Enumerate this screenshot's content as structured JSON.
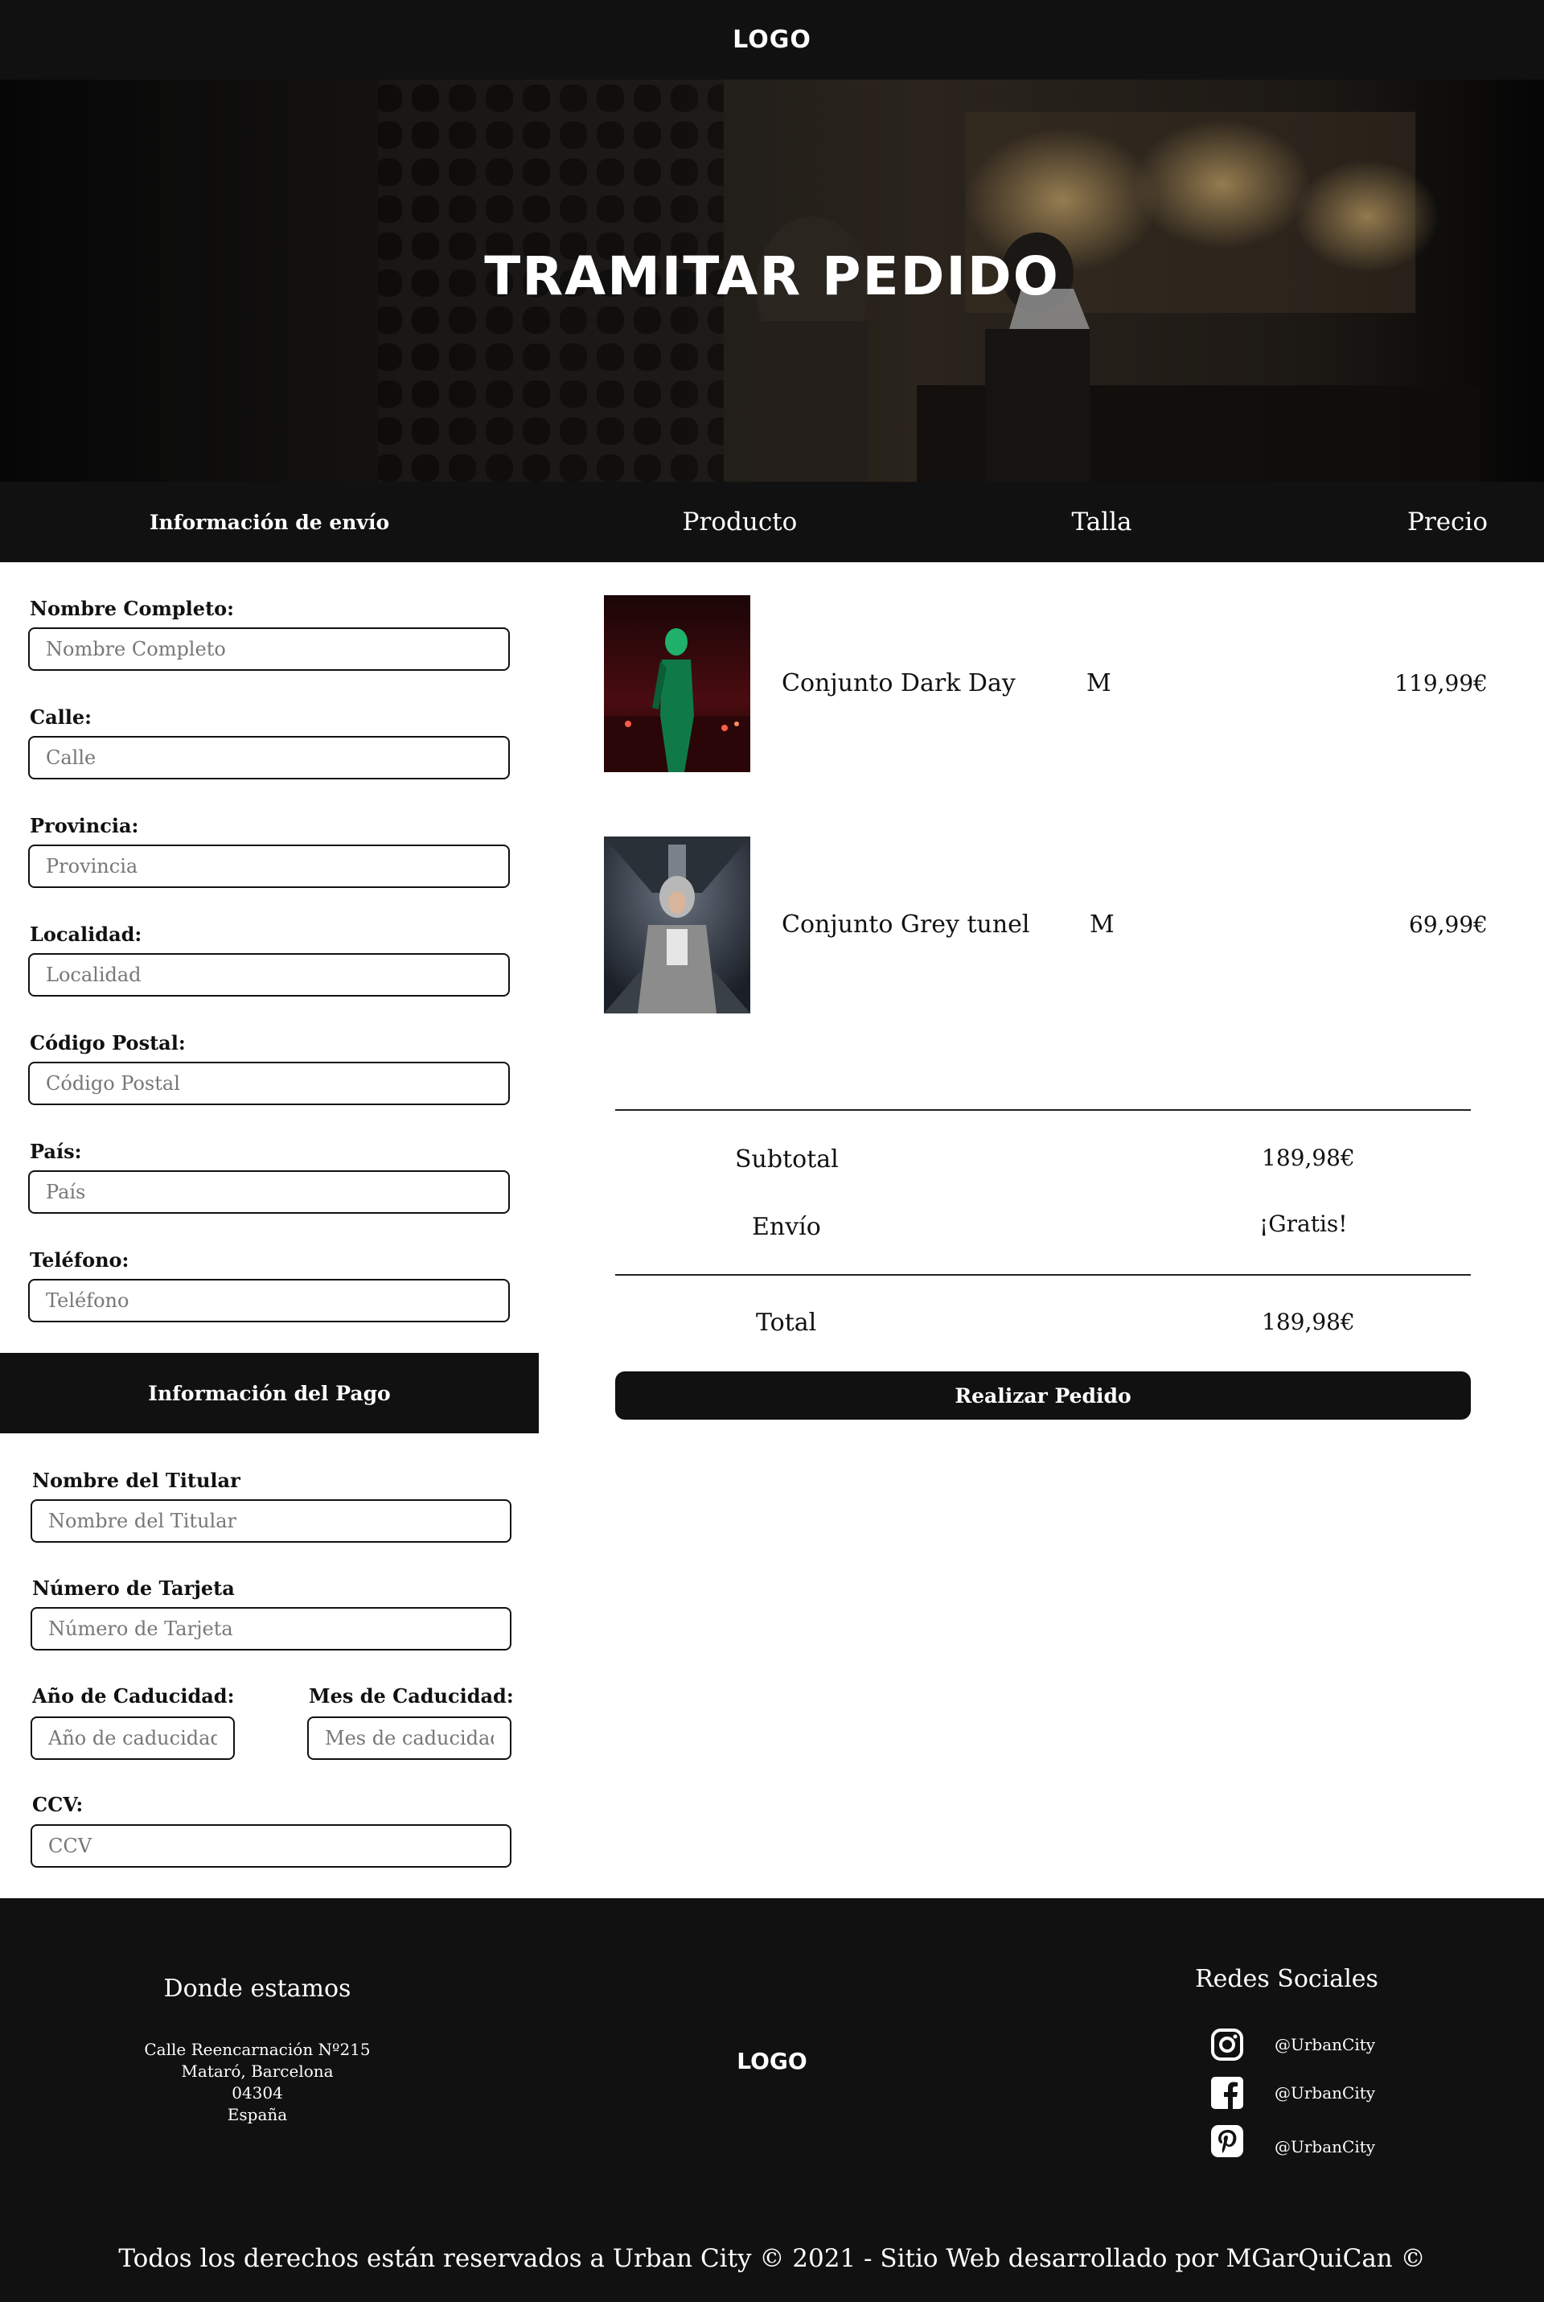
{
  "header": {
    "logo": "LOGO"
  },
  "hero": {
    "title": "TRAMITAR PEDIDO"
  },
  "columns": {
    "shipping_title": "Información de envío",
    "producto": "Producto",
    "talla": "Talla",
    "precio": "Precio"
  },
  "shipping_form": {
    "fields": [
      {
        "label": "Nombre Completo:",
        "placeholder": "Nombre Completo",
        "value": ""
      },
      {
        "label": "Calle:",
        "placeholder": "Calle",
        "value": ""
      },
      {
        "label": "Provincia:",
        "placeholder": "Provincia",
        "value": ""
      },
      {
        "label": "Localidad:",
        "placeholder": "Localidad",
        "value": ""
      },
      {
        "label": "Código Postal:",
        "placeholder": "Código Postal",
        "value": ""
      },
      {
        "label": "País:",
        "placeholder": "País",
        "value": ""
      },
      {
        "label": "Teléfono:",
        "placeholder": "Teléfono",
        "value": ""
      }
    ]
  },
  "payment": {
    "title": "Información del Pago",
    "holder": {
      "label": "Nombre del Titular",
      "placeholder": "Nombre del Titular"
    },
    "card": {
      "label": "Número de Tarjeta",
      "placeholder": "Número de Tarjeta"
    },
    "year": {
      "label": "Año de Caducidad:",
      "placeholder": "Año de caducidad"
    },
    "month": {
      "label": "Mes de Caducidad:",
      "placeholder": "Mes de caducidad"
    },
    "ccv": {
      "label": "CCV:",
      "placeholder": "CCV"
    }
  },
  "products": [
    {
      "name": "Conjunto Dark Day",
      "size": "M",
      "price": "119,99€"
    },
    {
      "name": "Conjunto Grey tunel",
      "size": "M",
      "price": "69,99€"
    }
  ],
  "summary": {
    "subtotal_label": "Subtotal",
    "subtotal_value": "189,98€",
    "shipping_label": "Envío",
    "shipping_value": "¡Gratis!",
    "total_label": "Total",
    "total_value": "189,98€"
  },
  "order_button": "Realizar Pedido",
  "footer": {
    "where_title": "Donde estamos",
    "address": [
      "Calle Reencarnación Nº215",
      "Mataró, Barcelona",
      "04304",
      "España"
    ],
    "logo": "LOGO",
    "social_title": "Redes Sociales",
    "social": [
      {
        "icon": "instagram-icon",
        "handle": "@UrbanCity"
      },
      {
        "icon": "facebook-icon",
        "handle": "@UrbanCity"
      },
      {
        "icon": "pinterest-icon",
        "handle": "@UrbanCity"
      }
    ],
    "copyright": "Todos los derechos están reservados a Urban City © 2021  - Sitio Web desarrollado por MGarQuiCan ©"
  }
}
